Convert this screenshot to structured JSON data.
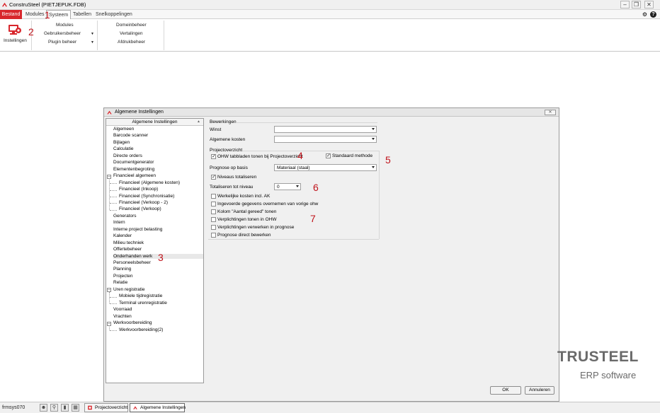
{
  "window": {
    "title": "ConstruSteel (PIETJEPUK.FDB)"
  },
  "menubar": {
    "items": [
      "Bestand",
      "Modules",
      "Systeem",
      "Tabellen",
      "Snelkoppelingen"
    ]
  },
  "ribbon": {
    "instellingen_label": "Instellingen",
    "col1": [
      "Modules",
      "Gebruikersbeheer",
      "Plugin beheer"
    ],
    "col2": [
      "Domeinbeheer",
      "Vertalingen",
      "Afdrukbeheer"
    ]
  },
  "dialog": {
    "title": "Algemene Instellingen",
    "close_glyph": "✕",
    "tree_header": "Algemene Instellingen",
    "tree": [
      {
        "label": "Algemeen",
        "level": 0
      },
      {
        "label": "Barcode scanner",
        "level": 0
      },
      {
        "label": "Bijlagen",
        "level": 0
      },
      {
        "label": "Calculatie",
        "level": 0
      },
      {
        "label": "Directe orders",
        "level": 0
      },
      {
        "label": "Documentgenerator",
        "level": 0
      },
      {
        "label": "Elementenbegroting",
        "level": 0
      },
      {
        "label": "Financieel algemeen",
        "level": 0,
        "expanded": true
      },
      {
        "label": "Financieel (Algemene kosten)",
        "level": 1
      },
      {
        "label": "Financieel (Inkoop)",
        "level": 1
      },
      {
        "label": "Financieel (Synchronisatie)",
        "level": 1
      },
      {
        "label": "Financieel (Verkoop - 2)",
        "level": 1
      },
      {
        "label": "Financieel (Verkoop)",
        "level": 1
      },
      {
        "label": "Generators",
        "level": 0
      },
      {
        "label": "Intern",
        "level": 0
      },
      {
        "label": "Interne project belasting",
        "level": 0
      },
      {
        "label": "Kalender",
        "level": 0
      },
      {
        "label": "Milieu techniek",
        "level": 0
      },
      {
        "label": "Offertebeheer",
        "level": 0
      },
      {
        "label": "Onderhanden werk",
        "level": 0,
        "selected": true
      },
      {
        "label": "Personeelsbeheer",
        "level": 0
      },
      {
        "label": "Planning",
        "level": 0
      },
      {
        "label": "Projecten",
        "level": 0
      },
      {
        "label": "Relatie",
        "level": 0
      },
      {
        "label": "Uren registratie",
        "level": 0,
        "expanded": true
      },
      {
        "label": "Mobiele tijdregistratie",
        "level": 1
      },
      {
        "label": "Terminal urenregistratie",
        "level": 1
      },
      {
        "label": "Voorraad",
        "level": 0
      },
      {
        "label": "Vrachten",
        "level": 0
      },
      {
        "label": "Werkvoorbereiding",
        "level": 0,
        "expanded": true
      },
      {
        "label": "Werkvoorbereiding(2)",
        "level": 1
      }
    ],
    "bewerkingen": {
      "label": "Bewerkingen",
      "winst_label": "Winst",
      "winst_value": "",
      "algemene_kosten_label": "Algemene kosten",
      "algemene_kosten_value": ""
    },
    "projectoverzicht": {
      "label": "Projectoverzicht",
      "ohw_tabbladen": {
        "label": "OHW tabbladen tonen bij Projectoverzicht",
        "checked": true
      },
      "standaard_methode": {
        "label": "Standaard methode",
        "checked": true
      },
      "prognose_label": "Prognose op basis",
      "prognose_value": "Materiaal (staal)",
      "niveaus_totaliseren": {
        "label": "Niveaus totaliseren",
        "checked": true
      },
      "totaliseren_label": "Totaliseren tot niveau",
      "totaliseren_value": "0",
      "options": [
        {
          "label": "Werkelijke kosten incl. AK",
          "checked": false
        },
        {
          "label": "Ingevoerde gegevens overnemen van vorige ohw",
          "checked": false
        },
        {
          "label": "Kolom \"Aantal gereed\" tonen",
          "checked": false
        },
        {
          "label": "Verplichtingen tonen in OHW",
          "checked": false
        },
        {
          "label": "Verplichtingen verwerken in prognose",
          "checked": false
        },
        {
          "label": "Prognose direct bewerken",
          "checked": false
        }
      ]
    },
    "ok_label": "OK",
    "annuleren_label": "Annuleren"
  },
  "annotations": [
    "1",
    "2",
    "3",
    "4",
    "5",
    "6",
    "7"
  ],
  "branding": {
    "main": "TRUSTEEL",
    "sub": "ERP software"
  },
  "statusbar": {
    "user": "frmsys070",
    "tasks": [
      "Projectoverzicht",
      "Algemene Instellingen"
    ]
  },
  "colors": {
    "accent_red": "#d8262c",
    "annotation_red": "#c0141c"
  }
}
